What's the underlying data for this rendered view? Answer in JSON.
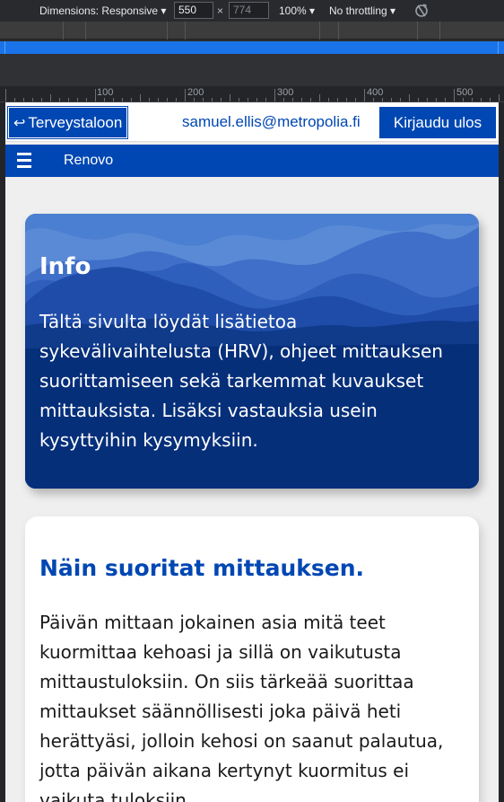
{
  "devtools": {
    "dimensions_label": "Dimensions: Responsive ▾",
    "width_value": "550",
    "times": "×",
    "height_placeholder": "774",
    "zoom": "100% ▾",
    "throttling": "No throttling ▾",
    "ruler_labels": [
      "100",
      "200",
      "300",
      "400",
      "500"
    ]
  },
  "nav": {
    "home_label": "Terveystaloon",
    "home_arrow": "↩",
    "email": "samuel.ellis@metropolia.fi",
    "logout_label": "Kirjaudu ulos"
  },
  "subnav": {
    "app_name": "Renovo"
  },
  "info": {
    "title": "Info",
    "text": "Tältä sivulta löydät lisätietoa sykevälivaihtelusta (HRV), ohjeet mittauksen suorittamiseen sekä tarkemmat kuvaukset mittauksista. Lisäksi vastauksia usein kysyttyihin kysymyksiin."
  },
  "content": {
    "title": "Näin suoritat mittauksen.",
    "text": "Päivän mittaan jokainen asia mitä teet kuormittaa kehoasi ja sillä on vaikutusta mittaustuloksiin. On siis tärkeää suorittaa mittaukset säännöllisesti joka päivä heti herättyäsi, jolloin kehosi on saanut palautua, jotta päivän aikana kertynyt kuormitus ei vaikuta tuloksiin."
  },
  "colors": {
    "brand_blue": "#0047b3",
    "background": "#efefef"
  }
}
